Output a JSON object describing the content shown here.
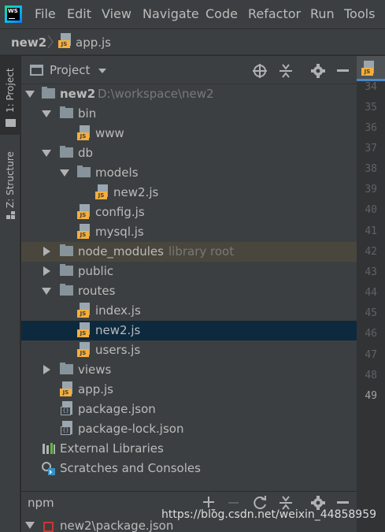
{
  "menu": {
    "logo": "WS",
    "items": [
      "File",
      "Edit",
      "View",
      "Navigate",
      "Code",
      "Refactor",
      "Run",
      "Tools"
    ]
  },
  "breadcrumb": {
    "project": "new2",
    "file": "app.js"
  },
  "toolstrip": {
    "project_tab": "1: Project",
    "structure_tab": "Z: Structure"
  },
  "panel": {
    "title": "Project",
    "icons": [
      "target-icon",
      "collapse-icon",
      "gear-icon",
      "minimize-icon"
    ]
  },
  "tree": {
    "root_label": "new2",
    "root_path": "D:\\workspace\\new2",
    "bin": "bin",
    "www": "www",
    "db": "db",
    "models": "models",
    "models_new2": "new2.js",
    "config": "config.js",
    "mysql": "mysql.js",
    "node_modules": "node_modules",
    "node_modules_hint": "library root",
    "public": "public",
    "routes": "routes",
    "index": "index.js",
    "routes_new2": "new2.js",
    "users": "users.js",
    "views": "views",
    "app": "app.js",
    "package": "package.json",
    "package_lock": "package-lock.json",
    "external": "External Libraries",
    "scratches": "Scratches and Consoles"
  },
  "gutter": {
    "lines": [
      "34",
      "35",
      "36",
      "37",
      "38",
      "39",
      "40",
      "41",
      "42",
      "43",
      "44",
      "45",
      "46",
      "47",
      "48",
      "49"
    ],
    "current_line": "49"
  },
  "npm": {
    "title": "npm",
    "item": "new2\\package.json"
  },
  "watermark": "https://blog.csdn.net/weixin_44858959",
  "colors": {
    "selected_row": "#0d293e",
    "library_row": "#49473d",
    "js_tag": "#f4af3d"
  }
}
